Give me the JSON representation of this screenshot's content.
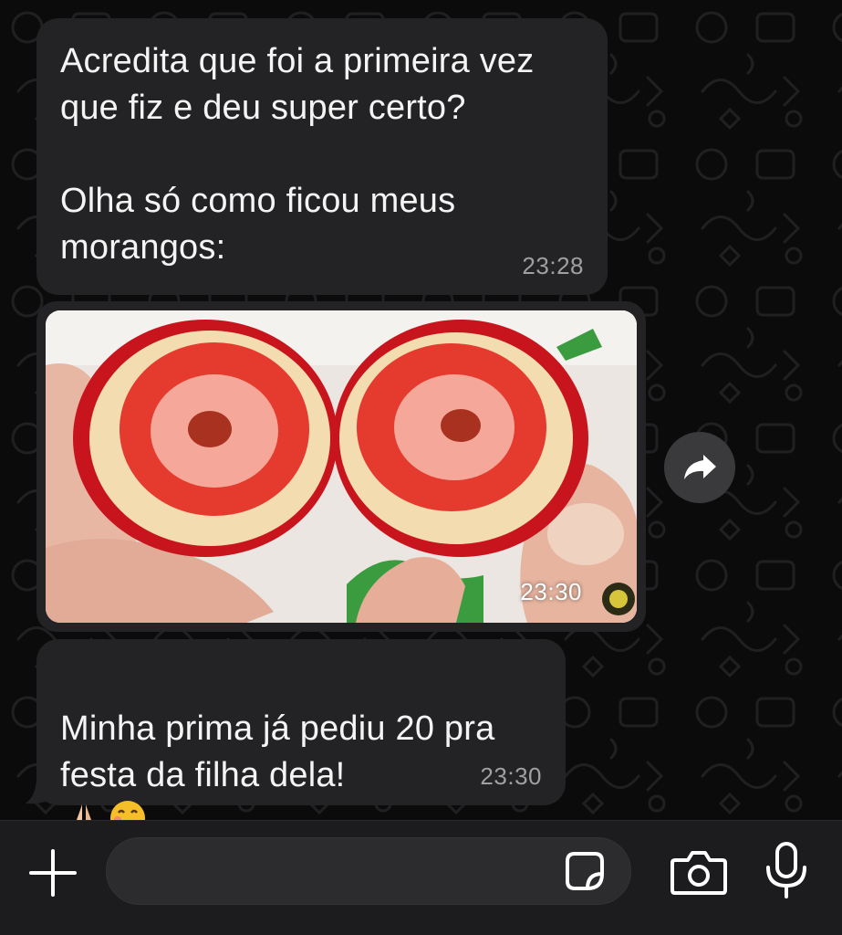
{
  "messages": [
    {
      "text": "Acredita que foi a primeira vez\nque fiz e deu super certo?\n\nOlha só como ficou meus\nmorangos:",
      "time": "23:28"
    },
    {
      "type": "image",
      "image_description": "strawberries",
      "time": "23:30"
    },
    {
      "text": "Minha prima já pediu 20 pra\nfesta da filha dela!",
      "emojis": [
        "praying-hands-emoji",
        "face-with-hand-over-mouth-emoji"
      ],
      "time": "23:30"
    }
  ],
  "icons": {
    "forward": "forward-arrow-icon",
    "attach": "plus-icon",
    "sticker": "sticker-icon",
    "camera": "camera-icon",
    "microphone": "microphone-icon"
  },
  "composer": {
    "value": ""
  },
  "colors": {
    "background": "#0b0b0b",
    "bubble": "#232325",
    "timestamp": "#a0a0a3",
    "composer_bar": "#1c1c1e",
    "input_field": "#2c2c2e"
  }
}
